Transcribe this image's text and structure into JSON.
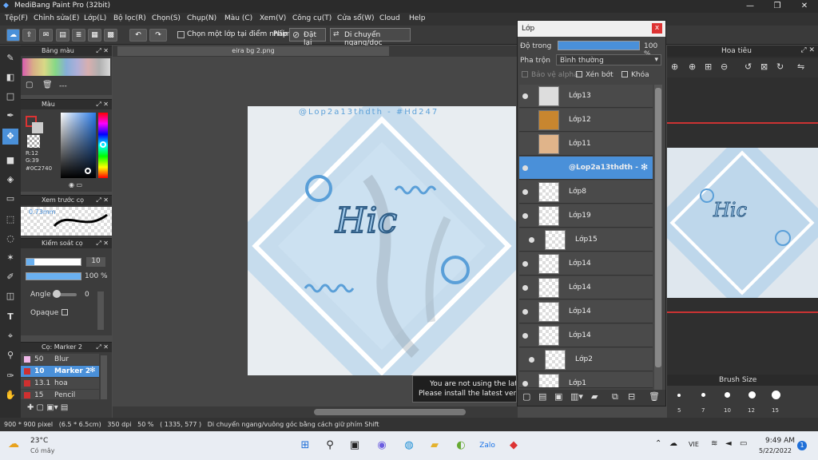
{
  "window": {
    "title": "MediBang Paint Pro (32bit)",
    "min": "—",
    "max": "❐",
    "close": "✕"
  },
  "menu": [
    "Tệp(F)",
    "Chỉnh sửa(E)",
    "Lớp(L)",
    "Bộ lọc(R)",
    "Chọn(S)",
    "Chụp(N)",
    "Màu (C)",
    "Xem(V)",
    "Công cụ(T)",
    "Cửa sổ(W)",
    "Cloud",
    "Help"
  ],
  "toolbar": {
    "check_label": "Chọn một lớp tại điểm nhấp",
    "phim": "Phím",
    "reset": "Đặt lại",
    "move": "Di chuyển ngang/dọc"
  },
  "panels": {
    "palette": "Bảng màu",
    "palette_value": "---",
    "color": "Màu",
    "rgb": {
      "r": "R:12",
      "g": "G:39",
      "b": "B:64",
      "hex": "#0C2740"
    },
    "brush_preview": "Xem trước cọ",
    "brush_size_label": "0.73mm",
    "brush_control": "Kiểm soát cọ",
    "size_value": "10",
    "opacity_value": "100 %",
    "angle_label": "Angle",
    "angle_value": "0",
    "opaque_label": "Opaque",
    "brush_list_title": "Cọ: Marker 2",
    "brushes": [
      {
        "size": "50",
        "name": "Blur",
        "color": "#f0b8e8"
      },
      {
        "size": "10",
        "name": "Marker 2",
        "color": "#d03030"
      },
      {
        "size": "13.1",
        "name": "hoa",
        "color": "#d03030"
      },
      {
        "size": "15",
        "name": "Pencil",
        "color": "#d03030"
      }
    ]
  },
  "canvas": {
    "tab": "eira bg 2.png",
    "watermark": "@Lop2a13thdth - #Hd247",
    "art_text": "Hic",
    "notice1": "You are not using the late",
    "notice2": "Please install the latest versi"
  },
  "layers": {
    "title": "Lớp",
    "close": "x",
    "opacity_label": "Độ trong",
    "opacity_value": "100 %",
    "opacity_fraction": 1.0,
    "blend_label": "Pha trộn",
    "blend_value": "Bình thường",
    "protect_alpha": "Bảo vệ alpha",
    "clipping": "Xén bớt",
    "lock": "Khóa",
    "items": [
      "Lớp13",
      "Lớp12",
      "Lớp11",
      "@Lop2a13thdth - ",
      "Lớp8",
      "Lớp19",
      "Lớp15",
      "Lớp14",
      "Lớp14",
      "Lớp14",
      "Lớp14",
      "Lớp2",
      "Lớp1"
    ]
  },
  "navigator": {
    "title": "Hoa tiêu",
    "art_text": "Hic"
  },
  "brush_size": {
    "title": "Brush Size",
    "sizes": [
      "5",
      "7",
      "10",
      "12",
      "15"
    ]
  },
  "status": {
    "info": "900 * 900 pixel   (6.5 * 6.5cm)   350 dpi   50 %   ( 1335, 577 )   Di chuyển ngang/vuông góc bằng cách giữ phím Shift"
  },
  "taskbar": {
    "temp": "23°C",
    "weather": "Có mây",
    "lang": "VIE",
    "time": "9:49 AM",
    "date": "5/22/2022",
    "badge": "1"
  }
}
